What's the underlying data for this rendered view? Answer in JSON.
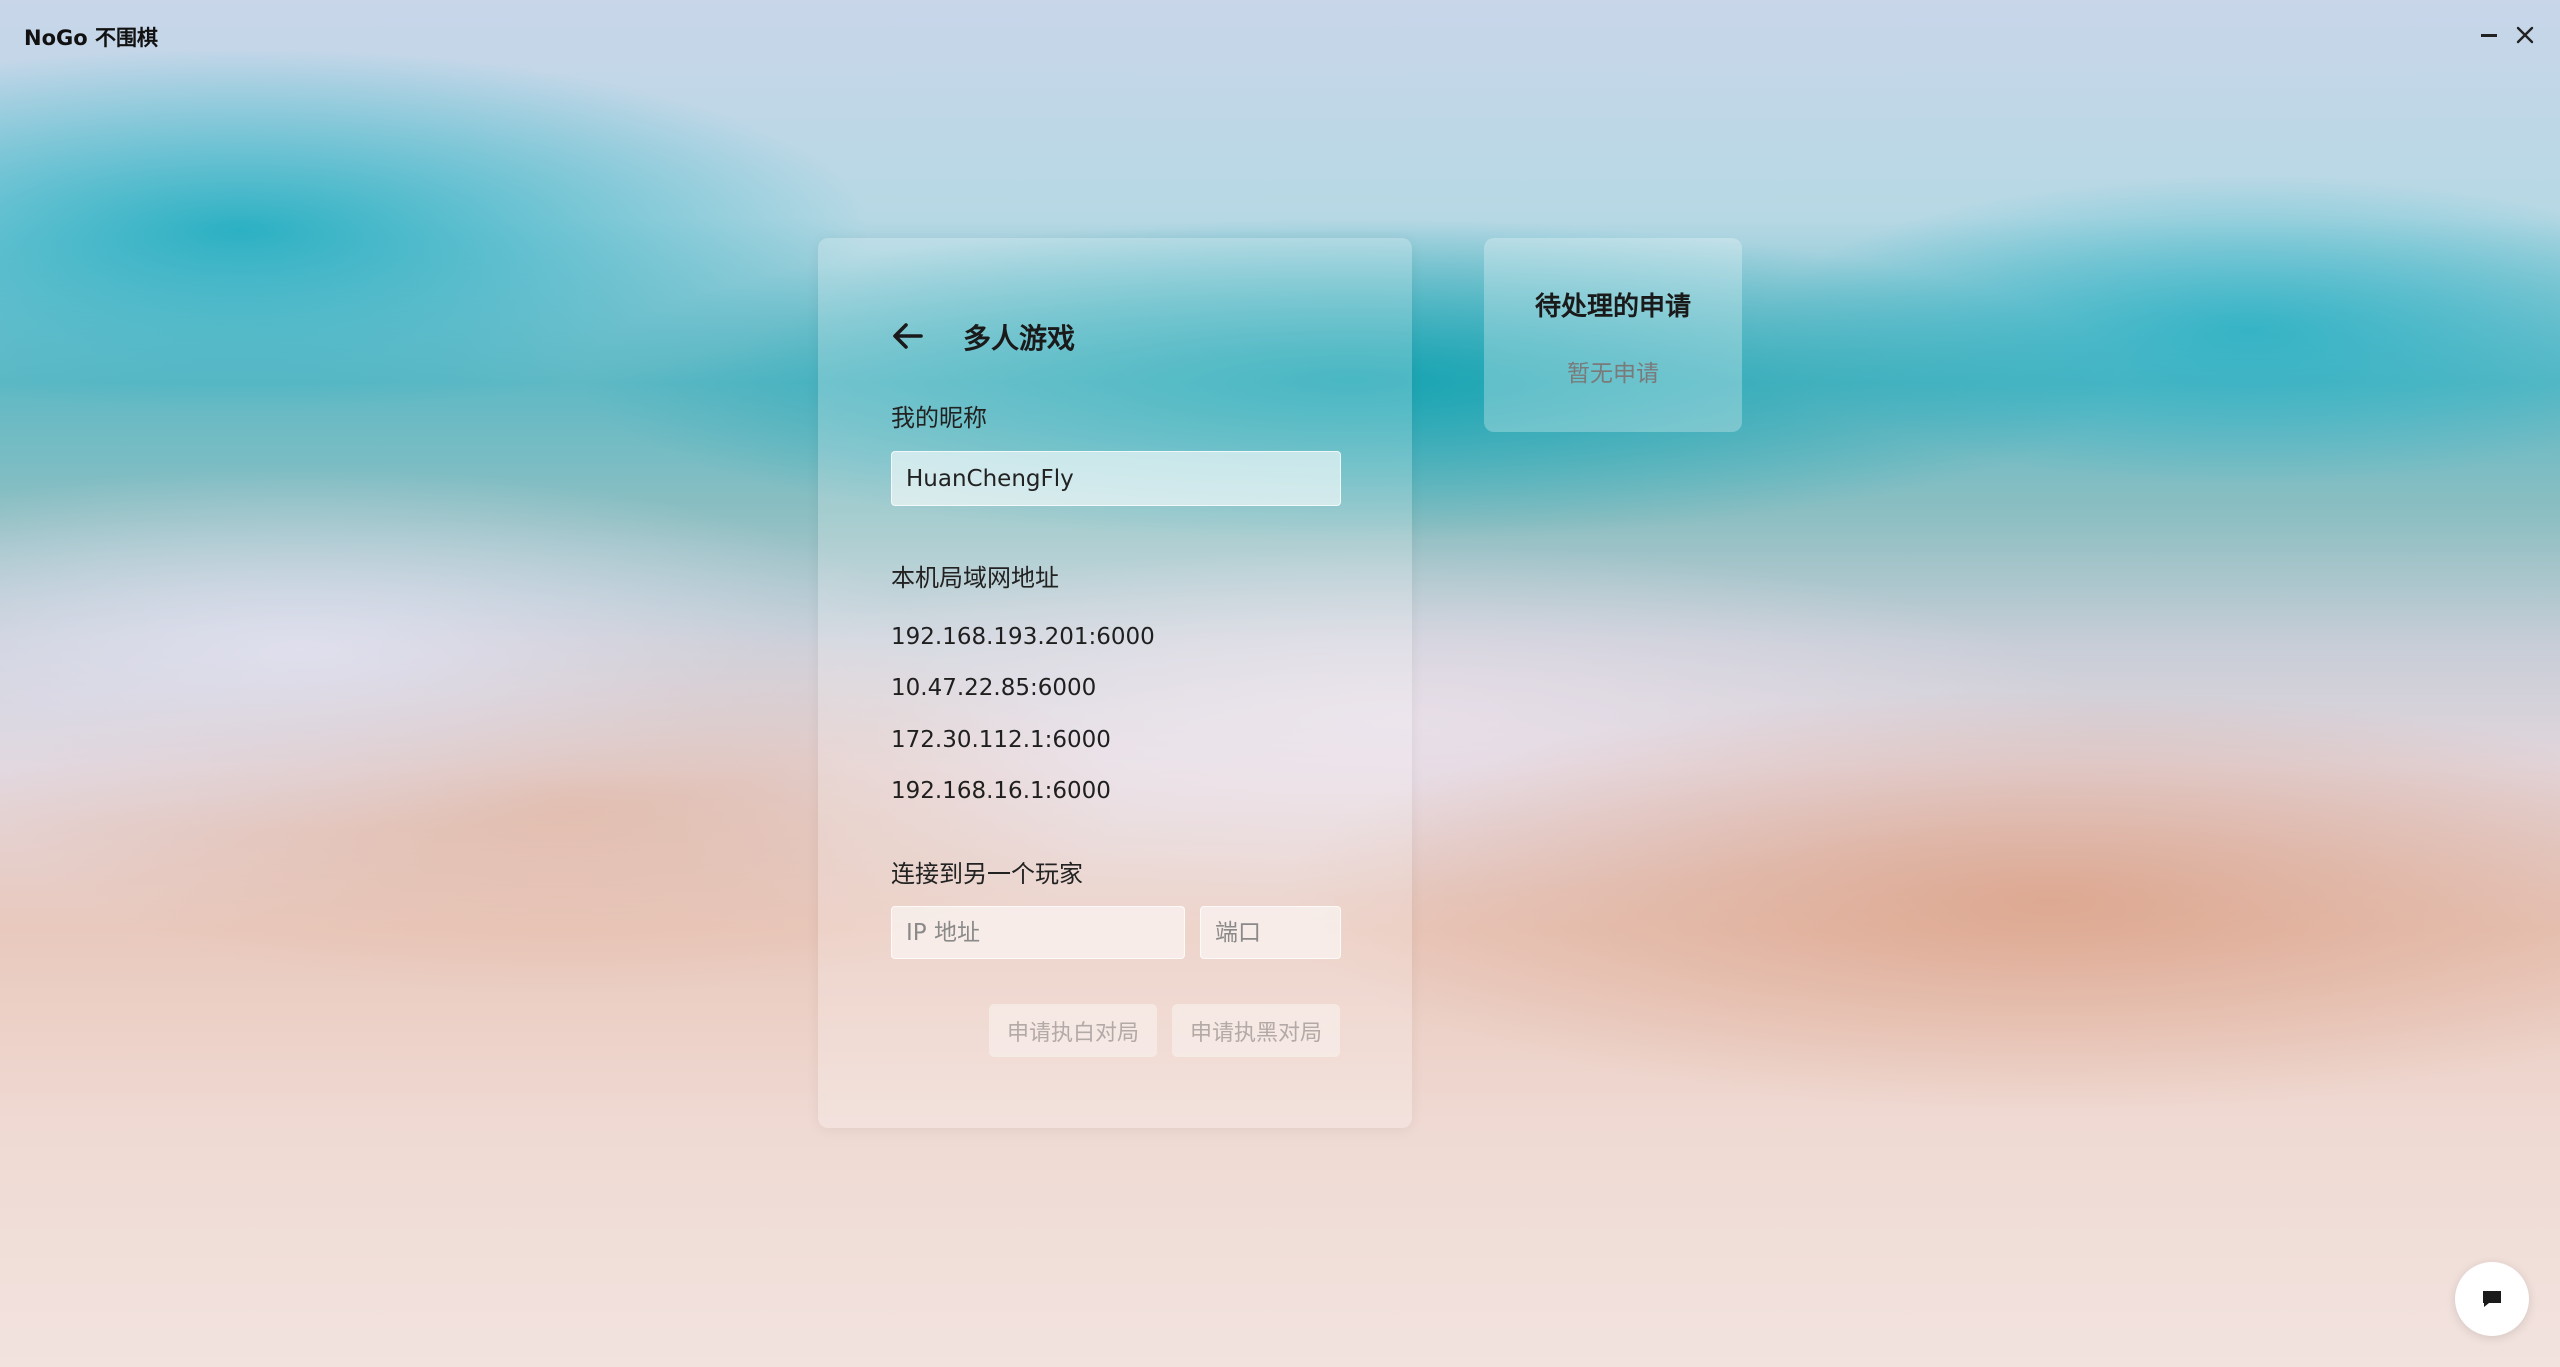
{
  "window": {
    "title": "NoGo 不围棋",
    "minimize_icon": "minimize-icon",
    "close_icon": "close-icon"
  },
  "multiplayer": {
    "back_icon": "arrow-left-icon",
    "title": "多人游戏",
    "nickname_label": "我的昵称",
    "nickname_value": "HuanChengFly",
    "lan_address_label": "本机局域网地址",
    "lan_addresses": [
      "192.168.193.201:6000",
      "10.47.22.85:6000",
      "172.30.112.1:6000",
      "192.168.16.1:6000"
    ],
    "connect_label": "连接到另一个玩家",
    "ip_placeholder": "IP 地址",
    "port_placeholder": "端口",
    "request_white_button": "申请执白对局",
    "request_black_button": "申请执黑对局"
  },
  "pending": {
    "title": "待处理的申请",
    "empty_text": "暂无申请"
  },
  "chat": {
    "icon": "chat-bubble-icon"
  },
  "colors": {
    "button_disabled_text": "#b3a9a6",
    "placeholder_text": "#8a8a8a"
  }
}
